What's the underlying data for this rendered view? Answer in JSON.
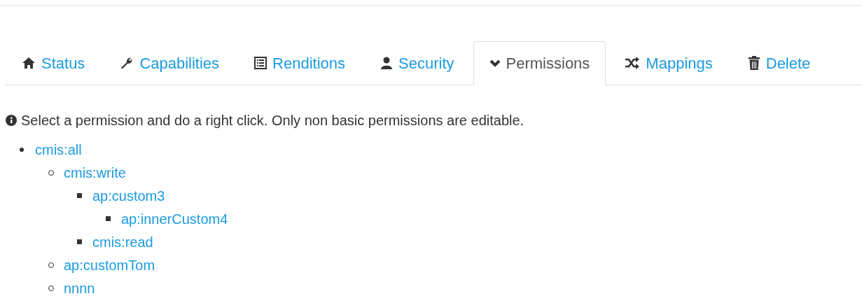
{
  "tabs": [
    {
      "label": "Status",
      "selected": false
    },
    {
      "label": "Capabilities",
      "selected": false
    },
    {
      "label": "Renditions",
      "selected": false
    },
    {
      "label": "Security",
      "selected": false
    },
    {
      "label": "Permissions",
      "selected": true
    },
    {
      "label": "Mappings",
      "selected": false
    },
    {
      "label": "Delete",
      "selected": false
    }
  ],
  "info_text": "Select a permission and do a right click. Only non basic permissions are editable.",
  "permissions": [
    {
      "label": "cmis:all",
      "children": [
        {
          "label": "cmis:write",
          "children": [
            {
              "label": "ap:custom3",
              "children": [
                {
                  "label": "ap:innerCustom4"
                }
              ]
            },
            {
              "label": "cmis:read"
            }
          ]
        },
        {
          "label": "ap:customTom"
        },
        {
          "label": "nnnn"
        }
      ]
    }
  ]
}
